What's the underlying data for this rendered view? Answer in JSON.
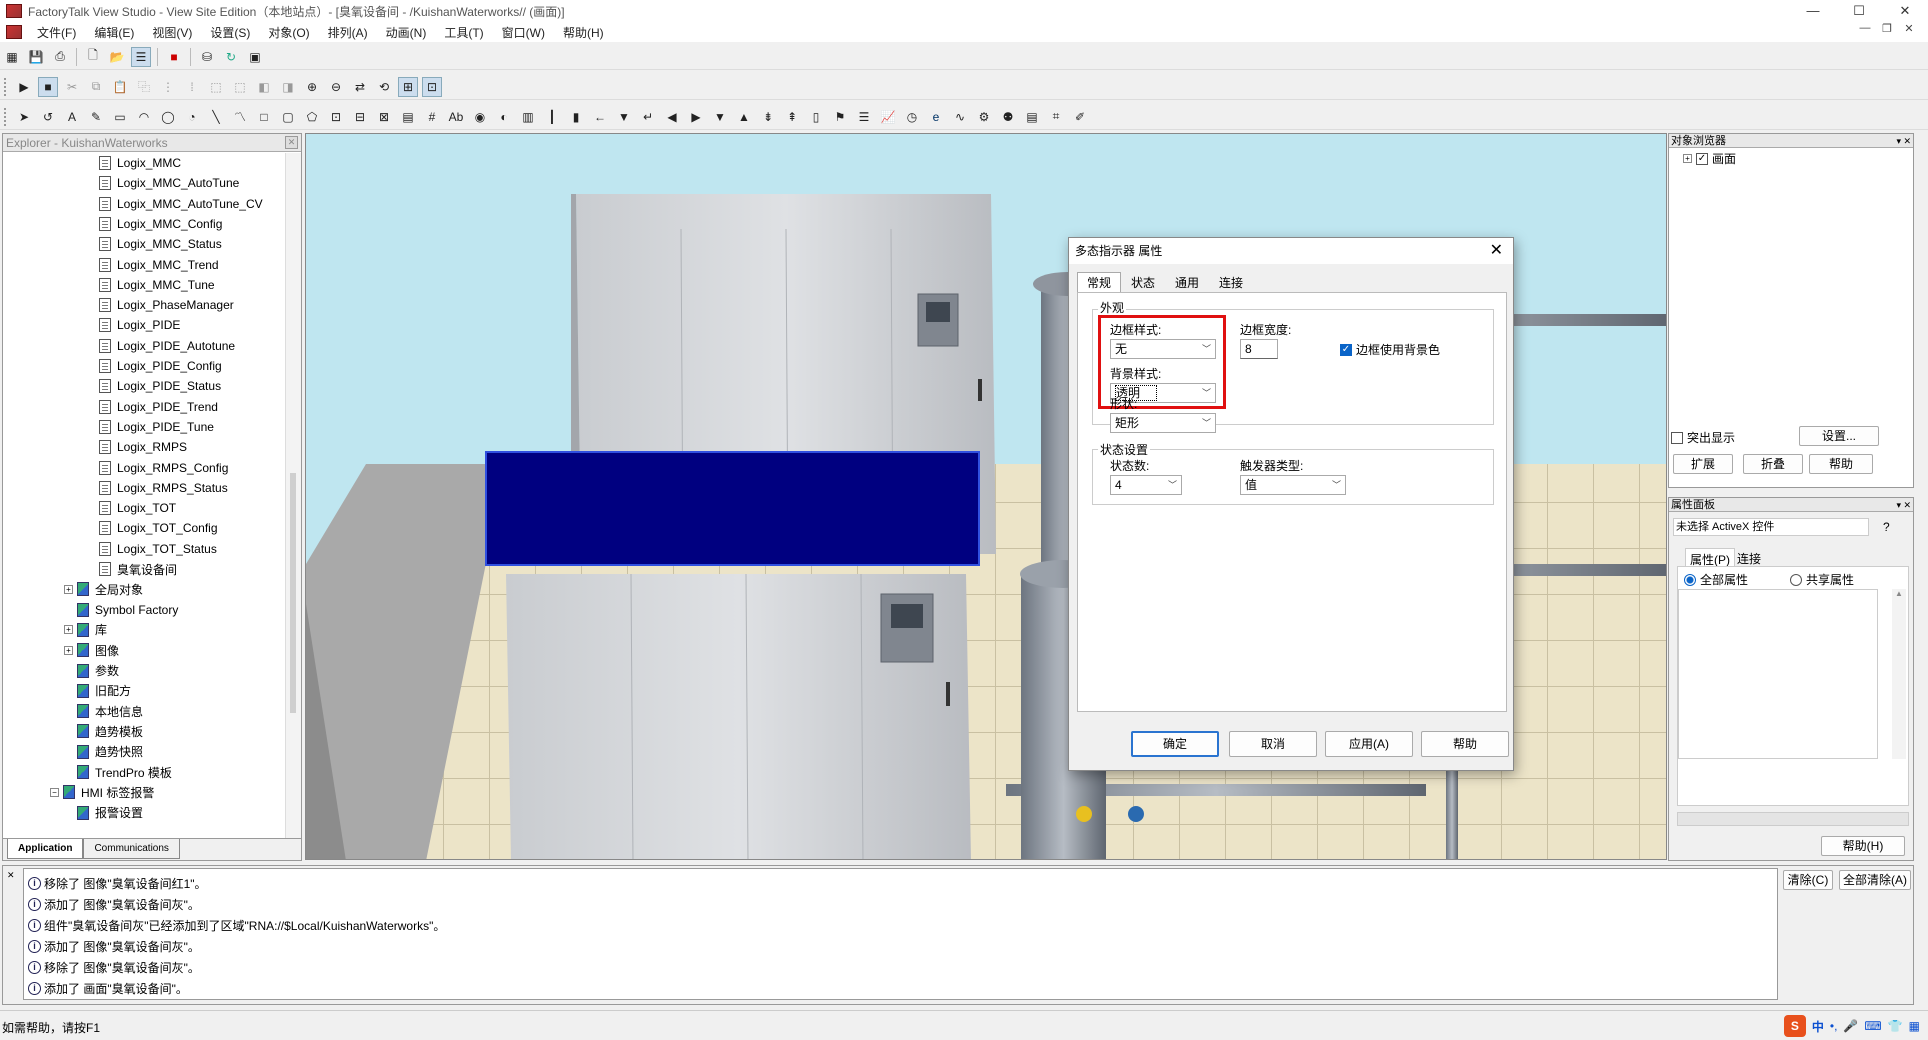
{
  "window": {
    "title": "FactoryTalk View Studio - View Site Edition（本地站点）- [臭氧设备间 - /KuishanWaterworks// (画面)]",
    "min": "—",
    "max": "☐",
    "close": "✕"
  },
  "menu": [
    "文件(F)",
    "编辑(E)",
    "视图(V)",
    "设置(S)",
    "对象(O)",
    "排列(A)",
    "动画(N)",
    "工具(T)",
    "窗口(W)",
    "帮助(H)"
  ],
  "explorer": {
    "header": "Explorer - KuishanWaterworks",
    "items": [
      {
        "label": "Logix_MMC",
        "level": 2
      },
      {
        "label": "Logix_MMC_AutoTune",
        "level": 2
      },
      {
        "label": "Logix_MMC_AutoTune_CV",
        "level": 2
      },
      {
        "label": "Logix_MMC_Config",
        "level": 2
      },
      {
        "label": "Logix_MMC_Status",
        "level": 2
      },
      {
        "label": "Logix_MMC_Trend",
        "level": 2
      },
      {
        "label": "Logix_MMC_Tune",
        "level": 2
      },
      {
        "label": "Logix_PhaseManager",
        "level": 2
      },
      {
        "label": "Logix_PIDE",
        "level": 2
      },
      {
        "label": "Logix_PIDE_Autotune",
        "level": 2
      },
      {
        "label": "Logix_PIDE_Config",
        "level": 2
      },
      {
        "label": "Logix_PIDE_Status",
        "level": 2
      },
      {
        "label": "Logix_PIDE_Trend",
        "level": 2
      },
      {
        "label": "Logix_PIDE_Tune",
        "level": 2
      },
      {
        "label": "Logix_RMPS",
        "level": 2
      },
      {
        "label": "Logix_RMPS_Config",
        "level": 2
      },
      {
        "label": "Logix_RMPS_Status",
        "level": 2
      },
      {
        "label": "Logix_TOT",
        "level": 2
      },
      {
        "label": "Logix_TOT_Config",
        "level": 2
      },
      {
        "label": "Logix_TOT_Status",
        "level": 2
      },
      {
        "label": "臭氧设备间",
        "level": 2
      },
      {
        "label": "全局对象",
        "level": 1,
        "expander": "+"
      },
      {
        "label": "Symbol Factory",
        "level": 1
      },
      {
        "label": "库",
        "level": 1,
        "expander": "+"
      },
      {
        "label": "图像",
        "level": 1,
        "expander": "+"
      },
      {
        "label": "参数",
        "level": 1
      },
      {
        "label": "旧配方",
        "level": 1
      },
      {
        "label": "本地信息",
        "level": 1
      },
      {
        "label": "趋势模板",
        "level": 1
      },
      {
        "label": "趋势快照",
        "level": 1
      },
      {
        "label": "TrendPro 模板",
        "level": 1
      },
      {
        "label": "HMI 标签报警",
        "level": 0,
        "expander": "−"
      },
      {
        "label": "报警设置",
        "level": 1
      }
    ],
    "tabs": [
      "Application",
      "Communications"
    ]
  },
  "object_browser": {
    "header": "对象浏览器",
    "tree_item": "画面",
    "highlight_label": "突出显示",
    "settings_btn": "设置...",
    "expand_btn": "扩展",
    "collapse_btn": "折叠",
    "help_btn": "帮助"
  },
  "property_panel": {
    "header": "属性面板",
    "selection": "未选择 ActiveX 控件",
    "help_q": "?",
    "tab_props": "属性(P)",
    "tab_conn": "连接",
    "radio_all": "全部属性",
    "radio_shared": "共享属性",
    "help_btn": "帮助(H)"
  },
  "dialog": {
    "title": "多态指示器 属性",
    "close": "✕",
    "tabs": [
      "常规",
      "状态",
      "通用",
      "连接"
    ],
    "appearance_group": "外观",
    "border_style_label": "边框样式:",
    "border_style_value": "无",
    "bg_style_label": "背景样式:",
    "bg_style_value": "透明",
    "border_width_label": "边框宽度:",
    "border_width_value": "8",
    "use_bg_color_label": "边框使用背景色",
    "use_bg_color_checked": true,
    "shape_label": "形状:",
    "shape_value": "矩形",
    "state_group": "状态设置",
    "state_count_label": "状态数:",
    "state_count_value": "4",
    "trigger_type_label": "触发器类型:",
    "trigger_type_value": "值",
    "ok": "确定",
    "cancel": "取消",
    "apply": "应用(A)",
    "help": "帮助",
    "highlight_color": "#e01010"
  },
  "output": {
    "lines": [
      "移除了 图像\"臭氧设备间红1\"。",
      "添加了 图像\"臭氧设备间灰\"。",
      "组件\"臭氧设备间灰\"已经添加到了区域\"RNA://$Local/KuishanWaterworks\"。",
      "添加了 图像\"臭氧设备间灰\"。",
      "移除了 图像\"臭氧设备间灰\"。",
      "添加了 画面\"臭氧设备间\"。"
    ],
    "clear_btn": "清除(C)",
    "clear_all_btn": "全部清除(A)"
  },
  "status": {
    "text": "如需帮助，请按F1",
    "ime": "中"
  },
  "colors": {
    "selection_rect": "#000080",
    "canvas_bg": "#bfe6f0"
  }
}
